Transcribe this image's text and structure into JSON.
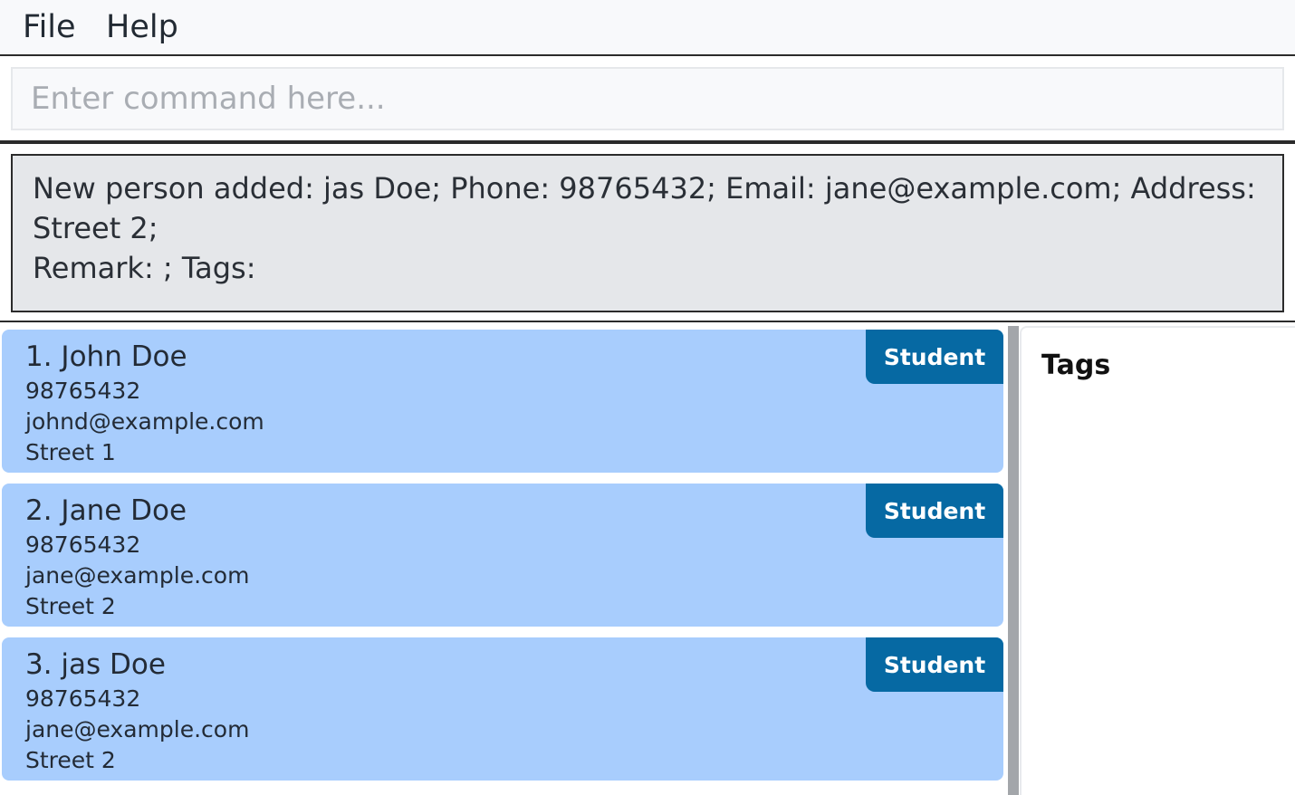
{
  "menu": {
    "file_label": "File",
    "help_label": "Help"
  },
  "command": {
    "placeholder": "Enter command here...",
    "value": ""
  },
  "result": {
    "line1": "New person added: jas Doe; Phone: 98765432; Email: jane@example.com; Address: Street 2;",
    "line2": "Remark: ; Tags:"
  },
  "persons": [
    {
      "name": "1. John Doe",
      "phone": "98765432",
      "email": "johnd@example.com",
      "address": "Street 1",
      "tag": "Student"
    },
    {
      "name": "2. Jane Doe",
      "phone": "98765432",
      "email": "jane@example.com",
      "address": "Street 2",
      "tag": "Student"
    },
    {
      "name": "3. jas Doe",
      "phone": "98765432",
      "email": "jane@example.com",
      "address": "Street 2",
      "tag": "Student"
    }
  ],
  "tags_panel": {
    "title": "Tags"
  },
  "colors": {
    "card_background": "#a8cdfd",
    "tag_chip": "#0669a3",
    "result_background": "#e5e7ea"
  }
}
